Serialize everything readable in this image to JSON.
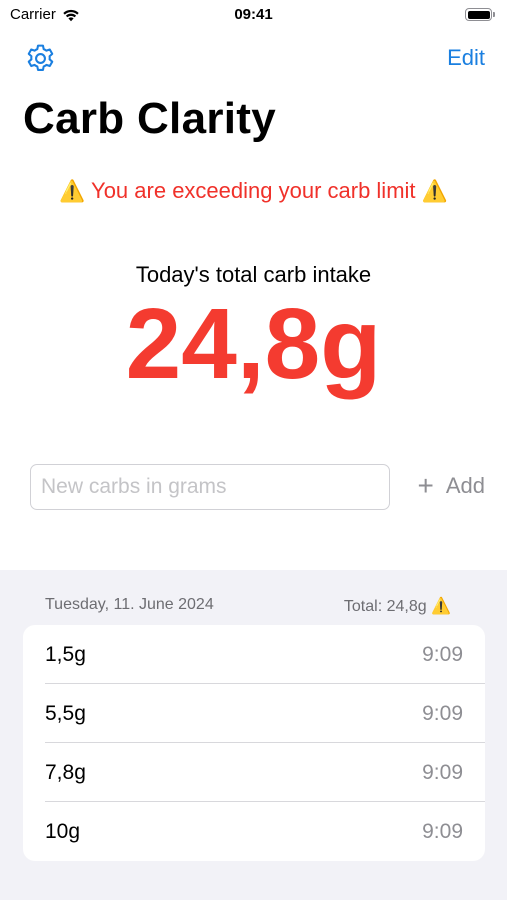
{
  "status_bar": {
    "carrier": "Carrier",
    "time": "09:41"
  },
  "nav": {
    "settings_icon": "gear-icon",
    "edit_label": "Edit"
  },
  "title": "Carb Clarity",
  "warning": {
    "icon": "⚠️",
    "text": "You are exceeding your carb limit"
  },
  "total": {
    "label": "Today's total carb intake",
    "value": "24,8g"
  },
  "input": {
    "placeholder": "New carbs in grams",
    "value": "",
    "add_label": "Add",
    "add_icon": "plus-icon"
  },
  "section": {
    "date": "Tuesday, 11. June 2024",
    "total": "Total: 24,8g"
  },
  "entries": [
    {
      "amount": "1,5g",
      "time": "9:09"
    },
    {
      "amount": "5,5g",
      "time": "9:09"
    },
    {
      "amount": "7,8g",
      "time": "9:09"
    },
    {
      "amount": "10g",
      "time": "9:09"
    }
  ],
  "colors": {
    "accent": "#1a7fe0",
    "warning": "#f0312a",
    "total_value": "#f43b30",
    "secondary": "#8e8e93",
    "grouped_background": "#f2f2f7"
  }
}
